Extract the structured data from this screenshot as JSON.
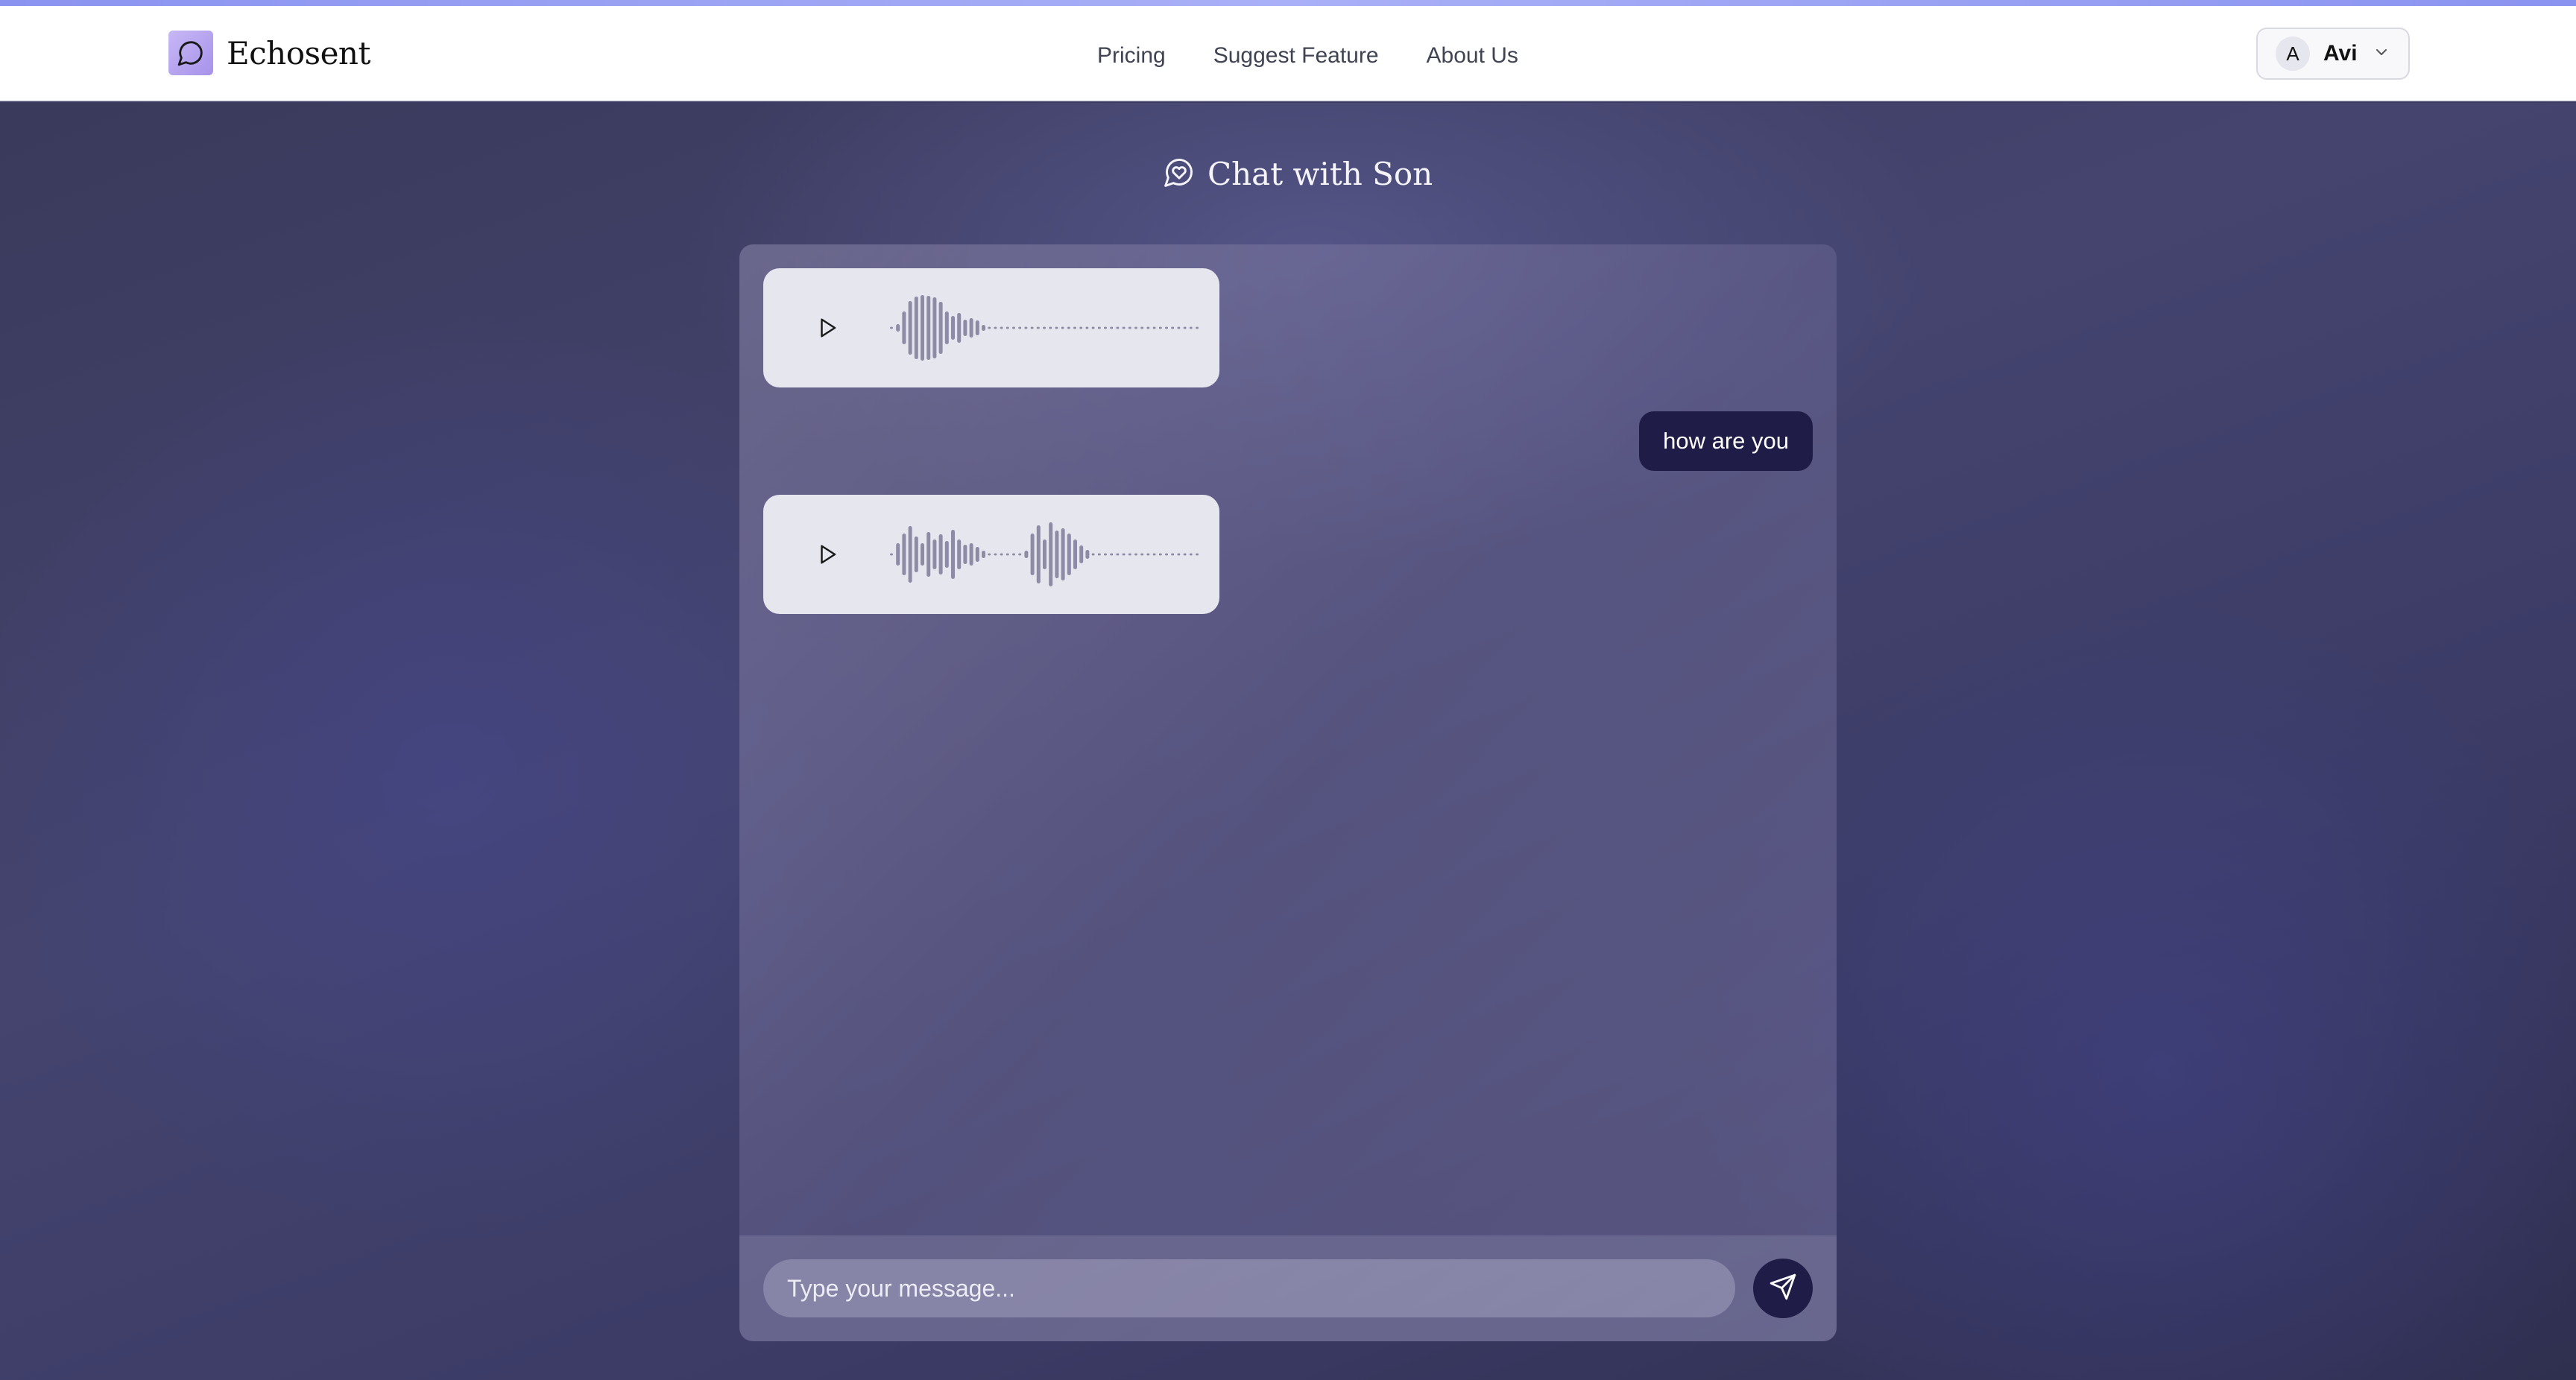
{
  "app": {
    "name": "Echosent",
    "logo_icon": "chat-bubble-icon",
    "accent": "#a792ea"
  },
  "nav": {
    "links": [
      {
        "label": "Pricing"
      },
      {
        "label": "Suggest Feature"
      },
      {
        "label": "About Us"
      }
    ]
  },
  "user": {
    "initial": "A",
    "name": "Avi",
    "menu_icon": "chevron-down-icon"
  },
  "chat": {
    "title": "Chat with Son",
    "title_icon": "heart-chat-icon",
    "messages": [
      {
        "type": "audio",
        "sender": "son"
      },
      {
        "type": "text",
        "sender": "user",
        "text": "how are you"
      },
      {
        "type": "audio",
        "sender": "son"
      }
    ],
    "input_placeholder": "Type your message...",
    "send_icon": "send-icon"
  },
  "colors": {
    "user_bubble": "#1f1d48",
    "audio_bubble": "#e6e6ee",
    "wave": "#8d8ba6"
  }
}
